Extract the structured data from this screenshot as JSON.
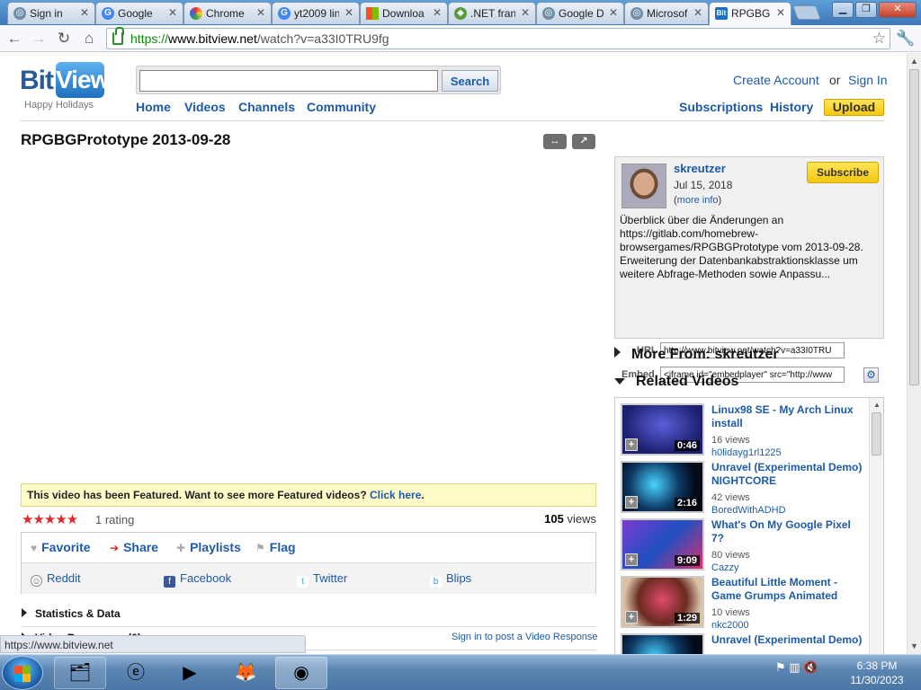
{
  "browser": {
    "tabs": [
      {
        "label": "Sign in",
        "icon": "globe-icon"
      },
      {
        "label": "Google",
        "icon": "google-icon"
      },
      {
        "label": "Chrome",
        "icon": "rainbow-icon"
      },
      {
        "label": "yt2009 lin",
        "icon": "google-icon"
      },
      {
        "label": "Downloa",
        "icon": "windows-icon"
      },
      {
        "label": ".NET fran",
        "icon": "dotnet-icon"
      },
      {
        "label": "Google D",
        "icon": "globe-icon"
      },
      {
        "label": "Microsof",
        "icon": "globe-icon"
      },
      {
        "label": "RPGBGPr",
        "icon": "bitview-icon"
      }
    ],
    "url_scheme": "https://",
    "url_host": "www.bitview.net",
    "url_path": "/watch?v=a33I0TRU9fg",
    "status_url": "https://www.bitview.net"
  },
  "header": {
    "logo_bit": "Bit",
    "logo_view": "View",
    "tagline": "Happy Holidays",
    "search_label": "Search",
    "nav": [
      "Home",
      "Videos",
      "Channels",
      "Community"
    ],
    "create_account": "Create Account",
    "or": "or",
    "sign_in": "Sign In",
    "subscriptions": "Subscriptions",
    "history": "History",
    "upload": "Upload"
  },
  "video": {
    "title": "RPGBGPrototype 2013-09-28",
    "featured_text": "This video has been Featured. Want to see more Featured videos?",
    "featured_link": "Click here",
    "featured_end": ".",
    "rating_count": "1 rating",
    "views_count": "105",
    "views_label": "views",
    "actions": [
      "Favorite",
      "Share",
      "Playlists",
      "Flag"
    ],
    "share_targets": [
      "Reddit",
      "Facebook",
      "Twitter",
      "Blips"
    ],
    "stats_label": "Statistics & Data",
    "responses_label": "Video Responses (0)",
    "post_response": "Sign in to post a Video Response"
  },
  "info": {
    "uploader": "skreutzer",
    "date": "Jul 15, 2018",
    "more_info_open": "(",
    "more_info": "more info",
    "more_info_close": ")",
    "subscribe": "Subscribe",
    "description": "Überblick über die Änderungen an https://gitlab.com/homebrew-browsergames/RPGBGPrototype vom 2013-09-28. Erweiterung der Datenbankabstraktionsklasse um weitere Abfrage-Methoden sowie Anpassu...",
    "url_label": "URL",
    "url_value": "http://www.bitview.net/watch?v=a33I0TRU",
    "embed_label": "Embed",
    "embed_value": "<iframe id=\"embedplayer\" src=\"http://www"
  },
  "sections": {
    "more_from": "More From: skreutzer",
    "related": "Related Videos"
  },
  "related": [
    {
      "title": "Linux98 SE - My Arch Linux install",
      "views": "16 views",
      "user": "h0lidayg1rl1225",
      "duration": "0:46"
    },
    {
      "title": "Unravel (Experimental Demo) NIGHTCORE",
      "views": "42 views",
      "user": "BoredWithADHD",
      "duration": "2:16"
    },
    {
      "title": "What's On My Google Pixel 7?",
      "views": "80 views",
      "user": "Cazzy",
      "duration": "9:09"
    },
    {
      "title": "Beautiful Little Moment - Game Grumps Animated",
      "views": "10 views",
      "user": "nkc2000",
      "duration": "1:29"
    },
    {
      "title": "Unravel (Experimental Demo)",
      "views": "",
      "user": "",
      "duration": ""
    }
  ],
  "taskbar": {
    "time": "6:38 PM",
    "date": "11/30/2023"
  }
}
